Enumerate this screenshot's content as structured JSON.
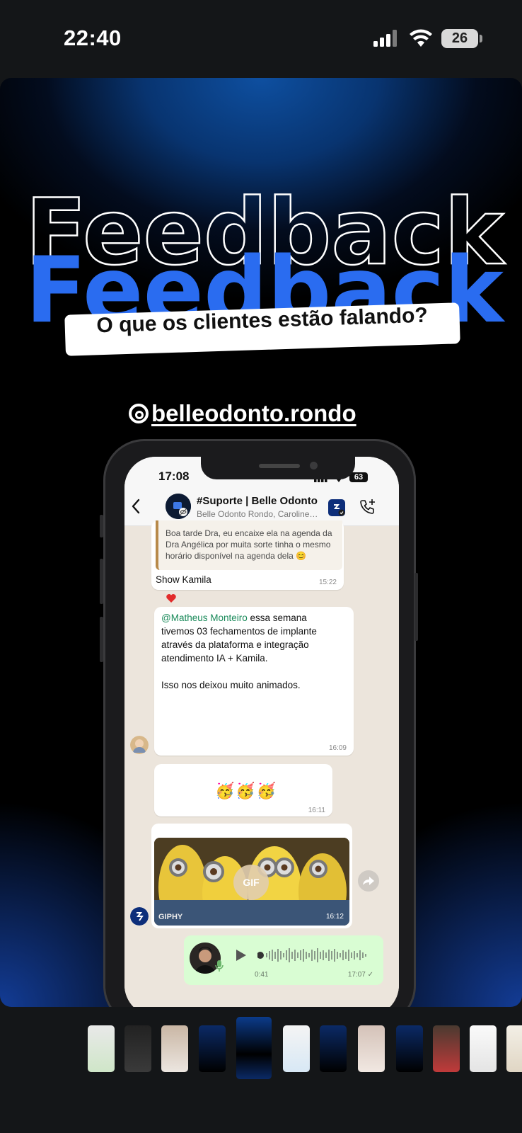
{
  "status_bar": {
    "time": "22:40",
    "battery": "26"
  },
  "story": {
    "headline_outline": "Feedback",
    "headline_solid": "Feedback",
    "subtitle": "O que os clientes estão falando?",
    "handle": "belleodonto.rondo",
    "colors": {
      "accent_blue": "#2a6cf0",
      "background": "#000000"
    }
  },
  "phone": {
    "status_time": "17:08",
    "battery": "63",
    "header": {
      "group_name": "#Suporte | Belle Odonto",
      "members": "Belle Odonto Rondo, Caroline…"
    },
    "messages": [
      {
        "quote_text": "Boa tarde Dra, eu encaixe ela na agenda da Dra Angélica por muita sorte tinha o mesmo horário disponível na agenda dela 😊",
        "text": "Show Kamila",
        "time": "15:22",
        "reaction": "heart"
      },
      {
        "mention": "@Matheus Monteiro",
        "text": " essa semana tivemos 03 fechamentos de implante através da plataforma e integração atendimento IA + Kamila.\n\nIsso nos deixou muito animados.",
        "time": "16:09"
      },
      {
        "emoji": "🥳🥳🥳",
        "time": "16:11"
      },
      {
        "gif_badge": "GIF",
        "gif_source": "GIPHY",
        "time": "16:12"
      },
      {
        "voice_duration": "0:41",
        "time": "17:07 ✓"
      }
    ]
  }
}
